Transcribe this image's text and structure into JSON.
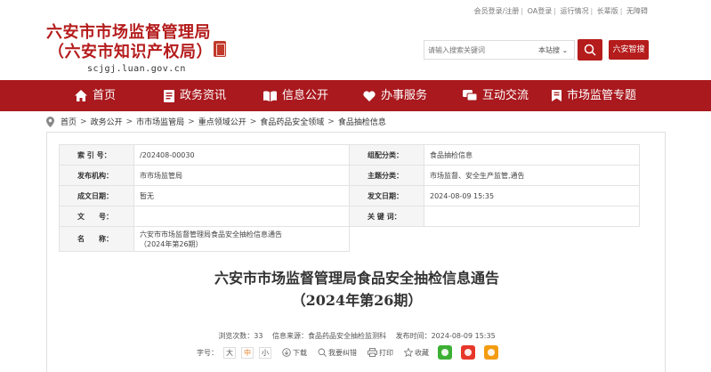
{
  "topbar": {
    "links": [
      "会员登录/注册",
      "OA登录",
      "运行情况",
      "长辈版",
      "无障碍"
    ]
  },
  "logo": {
    "line1": "六安市市场监督管理局",
    "line2": "（六安市知识产权局）",
    "url": "scjgj.luan.gov.cn"
  },
  "search": {
    "placeholder": "请输入搜索关键词",
    "scope": "本站搜 ⌄",
    "smart_label": "六安智搜"
  },
  "nav": {
    "items": [
      "首页",
      "政务资讯",
      "信息公开",
      "办事服务",
      "互动交流",
      "市场监管专题"
    ]
  },
  "breadcrumb": [
    "首页",
    "政务公开",
    "市市场监管局",
    "重点领域公开",
    "食品药品安全领域",
    "食品抽检信息"
  ],
  "info": {
    "index_label": "索 引 号：",
    "index_value": "/202408-00030",
    "category_label": "组配分类：",
    "category_value": "食品抽检信息",
    "org_label": "发布机构：",
    "org_value": "市市场监管局",
    "topic_label": "主题分类：",
    "topic_value": "市场监督、安全生产监管,通告",
    "created_label": "成文日期：",
    "created_value": "暂无",
    "published_label": "发文日期：",
    "published_value": "2024-08-09 15:35",
    "docno_label": "文　　号：",
    "docno_value": "",
    "keywords_label": "关 键 词：",
    "keywords_value": "",
    "name_label": "名　　称：",
    "name_value_1": "六安市市场监督管理局食品安全抽检信息通告",
    "name_value_2": "（2024年第26期）"
  },
  "article": {
    "title_line1": "六安市市场监督管理局食品安全抽检信息通告",
    "title_line2": "（2024年第26期）",
    "views": "浏览次数：33",
    "source": "信息来源：食品药品安全抽检监测科",
    "time": "发布时间：2024-08-09 15:35",
    "font_label": "字号：",
    "font_sizes": [
      "大",
      "中",
      "小"
    ],
    "download": "下载",
    "error": "我要纠错",
    "print": "打印",
    "favorite": "收藏"
  },
  "colors": {
    "brand_red": "#a9191e",
    "title_red": "#b51c1c"
  }
}
